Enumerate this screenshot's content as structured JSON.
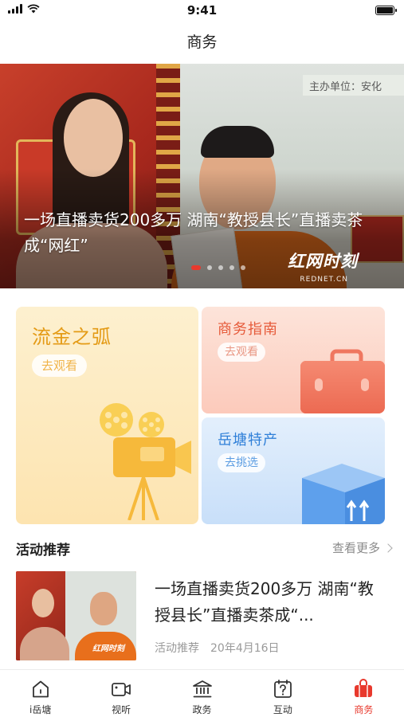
{
  "status_bar": {
    "time": "9:41"
  },
  "nav": {
    "title": "商务"
  },
  "banner": {
    "caption": "一场直播卖货200多万 湖南“教授县长”直播卖茶成“网红”",
    "sign_text": "主办单位：安化",
    "watermark": "红网时刻",
    "watermark_sub": "REDNET.CN",
    "dot_count": 5,
    "active_dot": 0
  },
  "cards": {
    "gold": {
      "title": "流金之弧",
      "action": "去观看",
      "icon": "film-camera-icon"
    },
    "red": {
      "title": "商务指南",
      "action": "去观看",
      "icon": "briefcase-icon"
    },
    "blue": {
      "title": "岳塘特产",
      "action": "去挑选",
      "icon": "package-box-icon"
    }
  },
  "section": {
    "title": "活动推荐",
    "more": "查看更多"
  },
  "activity": {
    "title": "一场直播卖货200多万 湖南“教授县长”直播卖茶成“...",
    "category": "活动推荐",
    "date": "20年4月16日"
  },
  "tabs": [
    {
      "label": "i岳塘",
      "icon": "home-icon",
      "active": false
    },
    {
      "label": "视听",
      "icon": "video-icon",
      "active": false
    },
    {
      "label": "政务",
      "icon": "government-icon",
      "active": false
    },
    {
      "label": "互动",
      "icon": "question-calendar-icon",
      "active": false
    },
    {
      "label": "商务",
      "icon": "shopping-bag-icon",
      "active": true
    }
  ],
  "colors": {
    "accent": "#e8392d",
    "gold": "#e49b16",
    "red_card": "#e65a3a",
    "blue_card": "#2f7fd8"
  }
}
